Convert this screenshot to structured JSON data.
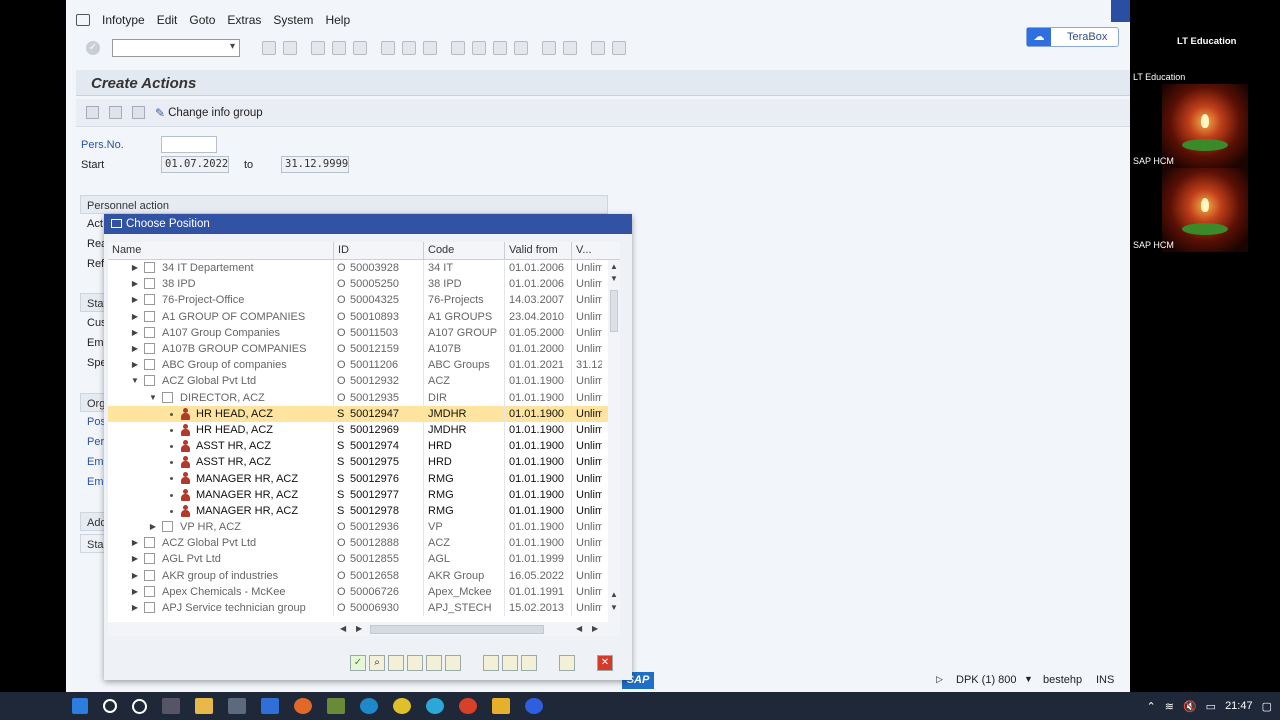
{
  "menu": [
    "Infotype",
    "Edit",
    "Goto",
    "Extras",
    "System",
    "Help"
  ],
  "terabox": "TeraBox",
  "title": "Create Actions",
  "app_toolbar": {
    "change_info_group": "Change info group"
  },
  "form": {
    "pers_no_label": "Pers.No.",
    "pers_no_value": "",
    "start_label": "Start",
    "start_value": "01.07.2022",
    "to_label": "to",
    "end_value": "31.12.9999",
    "personnel_action": "Personnel action",
    "action_abbr": "Act",
    "reason_abbr": "Rea",
    "ref_abbr": "Ref",
    "status_abbr": "Stat",
    "cust_abbr": "Cus",
    "emp1_abbr": "Emp",
    "spe_abbr": "Spe",
    "org_abbr": "Org",
    "pos_abbr": "Pos",
    "per_abbr": "Per",
    "emp2_abbr": "Emp",
    "emp3_abbr": "Emp",
    "add_abbr": "Add",
    "sta_abbr": "Sta"
  },
  "dialog": {
    "title": "Choose Position",
    "columns": [
      "Name",
      "ID",
      "Code",
      "Valid from",
      "V..."
    ],
    "rows": [
      {
        "name": "34 IT Departement",
        "type": "O",
        "id": "50003928",
        "code": "34 IT",
        "from": "01.01.2006",
        "to": "Unlim",
        "level": 0,
        "kind": "org",
        "expanded": false
      },
      {
        "name": "38 IPD",
        "type": "O",
        "id": "50005250",
        "code": "38 IPD",
        "from": "01.01.2006",
        "to": "Unlim",
        "level": 0,
        "kind": "org",
        "expanded": false
      },
      {
        "name": "76-Project-Office",
        "type": "O",
        "id": "50004325",
        "code": "76-Projects",
        "from": "14.03.2007",
        "to": "Unlim",
        "level": 0,
        "kind": "org",
        "expanded": false
      },
      {
        "name": "A1 GROUP OF COMPANIES",
        "type": "O",
        "id": "50010893",
        "code": "A1 GROUPS",
        "from": "23.04.2010",
        "to": "Unlim",
        "level": 0,
        "kind": "org",
        "expanded": false
      },
      {
        "name": "A107 Group Companies",
        "type": "O",
        "id": "50011503",
        "code": "A107 GROUP",
        "from": "01.05.2000",
        "to": "Unlim",
        "level": 0,
        "kind": "org",
        "expanded": false
      },
      {
        "name": "A107B GROUP COMPANIES",
        "type": "O",
        "id": "50012159",
        "code": "A107B",
        "from": "01.01.2000",
        "to": "Unlim",
        "level": 0,
        "kind": "org",
        "expanded": false
      },
      {
        "name": "ABC Group of companies",
        "type": "O",
        "id": "50011206",
        "code": "ABC Groups",
        "from": "01.01.2021",
        "to": "31.12",
        "level": 0,
        "kind": "org",
        "expanded": false
      },
      {
        "name": "ACZ Global Pvt Ltd",
        "type": "O",
        "id": "50012932",
        "code": "ACZ",
        "from": "01.01.1900",
        "to": "Unlim",
        "level": 0,
        "kind": "org",
        "expanded": true
      },
      {
        "name": "DIRECTOR, ACZ",
        "type": "O",
        "id": "50012935",
        "code": "DIR",
        "from": "01.01.1900",
        "to": "Unlim",
        "level": 1,
        "kind": "org",
        "expanded": true
      },
      {
        "name": "HR HEAD, ACZ",
        "type": "S",
        "id": "50012947",
        "code": "JMDHR",
        "from": "01.01.1900",
        "to": "Unlim",
        "level": 2,
        "kind": "pos",
        "selected": true
      },
      {
        "name": "HR HEAD, ACZ",
        "type": "S",
        "id": "50012969",
        "code": "JMDHR",
        "from": "01.01.1900",
        "to": "Unlim",
        "level": 2,
        "kind": "pos"
      },
      {
        "name": "ASST HR, ACZ",
        "type": "S",
        "id": "50012974",
        "code": "HRD",
        "from": "01.01.1900",
        "to": "Unlim",
        "level": 2,
        "kind": "pos"
      },
      {
        "name": "ASST HR, ACZ",
        "type": "S",
        "id": "50012975",
        "code": "HRD",
        "from": "01.01.1900",
        "to": "Unlim",
        "level": 2,
        "kind": "pos"
      },
      {
        "name": "MANAGER HR, ACZ",
        "type": "S",
        "id": "50012976",
        "code": "RMG",
        "from": "01.01.1900",
        "to": "Unlim",
        "level": 2,
        "kind": "pos"
      },
      {
        "name": "MANAGER HR, ACZ",
        "type": "S",
        "id": "50012977",
        "code": "RMG",
        "from": "01.01.1900",
        "to": "Unlim",
        "level": 2,
        "kind": "pos"
      },
      {
        "name": "MANAGER HR, ACZ",
        "type": "S",
        "id": "50012978",
        "code": "RMG",
        "from": "01.01.1900",
        "to": "Unlim",
        "level": 2,
        "kind": "pos"
      },
      {
        "name": "VP HR, ACZ",
        "type": "O",
        "id": "50012936",
        "code": "VP",
        "from": "01.01.1900",
        "to": "Unlim",
        "level": 1,
        "kind": "org",
        "expanded": false
      },
      {
        "name": "ACZ Global Pvt Ltd",
        "type": "O",
        "id": "50012888",
        "code": "ACZ",
        "from": "01.01.1900",
        "to": "Unlim",
        "level": 0,
        "kind": "org",
        "expanded": false
      },
      {
        "name": "AGL Pvt Ltd",
        "type": "O",
        "id": "50012855",
        "code": "AGL",
        "from": "01.01.1999",
        "to": "Unlim",
        "level": 0,
        "kind": "org",
        "expanded": false
      },
      {
        "name": "AKR group of industries",
        "type": "O",
        "id": "50012658",
        "code": "AKR Group",
        "from": "16.05.2022",
        "to": "Unlim",
        "level": 0,
        "kind": "org",
        "expanded": false
      },
      {
        "name": "Apex Chemicals - McKee",
        "type": "O",
        "id": "50006726",
        "code": "Apex_Mckee",
        "from": "01.01.1991",
        "to": "Unlim",
        "level": 0,
        "kind": "org",
        "expanded": false
      },
      {
        "name": "APJ Service technician group",
        "type": "O",
        "id": "50006930",
        "code": "APJ_STECH",
        "from": "15.02.2013",
        "to": "Unlim",
        "level": 0,
        "kind": "org",
        "expanded": false
      }
    ]
  },
  "status_bar": {
    "system": "DPK (1) 800",
    "user": "bestehp",
    "mode": "INS",
    "sap": "SAP"
  },
  "participants": {
    "header": "LT Education",
    "p1": "LT Education",
    "p2": "SAP HCM",
    "p3": "SAP HCM"
  },
  "taskbar": {
    "time": "21:47"
  }
}
